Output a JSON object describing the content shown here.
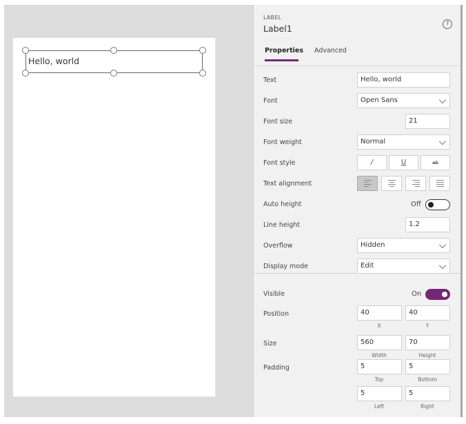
{
  "canvas": {
    "label_text": "Hello, world"
  },
  "panel": {
    "control_type": "LABEL",
    "control_name": "Label1",
    "help_icon": "?",
    "tabs": [
      {
        "label": "Properties",
        "active": true
      },
      {
        "label": "Advanced",
        "active": false
      }
    ],
    "accent_color": "#742774",
    "properties": {
      "text": {
        "label": "Text",
        "value": "Hello, world"
      },
      "font": {
        "label": "Font",
        "value": "Open Sans"
      },
      "font_size": {
        "label": "Font size",
        "value": "21"
      },
      "font_weight": {
        "label": "Font weight",
        "value": "Normal"
      },
      "font_style": {
        "label": "Font style",
        "buttons": [
          {
            "name": "italic",
            "glyph": "/"
          },
          {
            "name": "underline",
            "glyph": "U"
          },
          {
            "name": "strikethrough",
            "glyph": "ab"
          }
        ]
      },
      "text_alignment": {
        "label": "Text alignment",
        "selected": "left",
        "buttons": [
          "left",
          "center",
          "right",
          "justify"
        ]
      },
      "auto_height": {
        "label": "Auto height",
        "state": "Off"
      },
      "line_height": {
        "label": "Line height",
        "value": "1.2"
      },
      "overflow": {
        "label": "Overflow",
        "value": "Hidden"
      },
      "display_mode": {
        "label": "Display mode",
        "value": "Edit"
      },
      "visible": {
        "label": "Visible",
        "state": "On"
      },
      "position": {
        "label": "Position",
        "x": "40",
        "y": "40",
        "x_label": "X",
        "y_label": "Y"
      },
      "size": {
        "label": "Size",
        "width": "560",
        "height": "70",
        "width_label": "Width",
        "height_label": "Height"
      },
      "padding": {
        "label": "Padding",
        "top": "5",
        "bottom": "5",
        "left": "5",
        "right": "5",
        "top_label": "Top",
        "bottom_label": "Bottom",
        "left_label": "Left",
        "right_label": "Right"
      }
    }
  }
}
